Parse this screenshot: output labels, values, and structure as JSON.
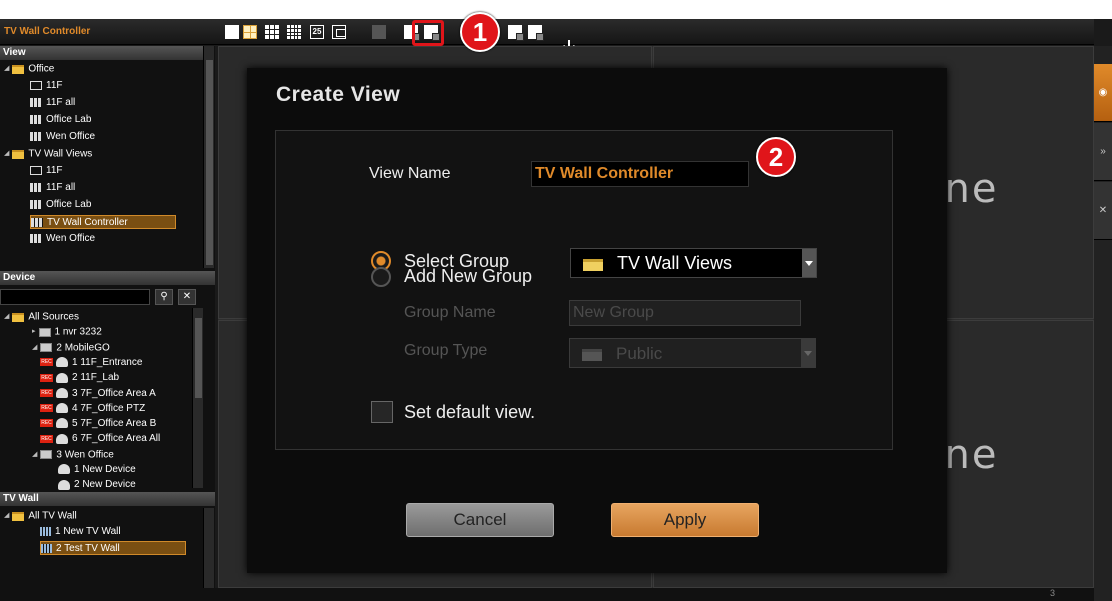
{
  "app": {
    "title": "TV Wall Controller"
  },
  "callouts": [
    "1",
    "2"
  ],
  "left_panel": {
    "view_header": "View",
    "views": [
      {
        "label": "Office",
        "type": "folder"
      },
      {
        "label": "11F",
        "type": "single"
      },
      {
        "label": "11F all",
        "type": "mixed"
      },
      {
        "label": "Office Lab",
        "type": "quad"
      },
      {
        "label": "Wen Office",
        "type": "grid"
      },
      {
        "label": "TV Wall Views",
        "type": "folder"
      },
      {
        "label": "11F",
        "type": "single"
      },
      {
        "label": "11F all",
        "type": "mixed"
      },
      {
        "label": "Office Lab",
        "type": "quad"
      },
      {
        "label": "TV Wall Controller",
        "type": "quad",
        "selected": true
      },
      {
        "label": "Wen Office",
        "type": "grid"
      }
    ],
    "device_header": "Device",
    "devices": [
      {
        "label": "All Sources"
      },
      {
        "label": "1 nvr 3232"
      },
      {
        "label": "2 MobileGO"
      },
      {
        "label": "1 11F_Entrance"
      },
      {
        "label": "2 11F_Lab"
      },
      {
        "label": "3 7F_Office Area A"
      },
      {
        "label": "4 7F_Office PTZ"
      },
      {
        "label": "5 7F_Office Area B"
      },
      {
        "label": "6 7F_Office Area All"
      },
      {
        "label": "3 Wen Office"
      },
      {
        "label": "1 New Device"
      },
      {
        "label": "2 New Device"
      }
    ],
    "tvwall_header": "TV Wall",
    "tvwalls": [
      {
        "label": "All TV Wall"
      },
      {
        "label": "1 New TV Wall"
      },
      {
        "label": "2 Test TV Wall",
        "selected": true
      }
    ]
  },
  "main": {
    "brand_text": "one"
  },
  "status": {
    "count": "3"
  },
  "dialog": {
    "title": "Create View",
    "view_name_label": "View Name",
    "view_name_value": "TV Wall Controller",
    "select_group_label": "Select Group",
    "select_group_value": "TV  Wall Views",
    "add_group_label": "Add New Group",
    "group_name_label": "Group Name",
    "group_name_placeholder": "New Group",
    "group_type_label": "Group Type",
    "group_type_value": "Public",
    "default_view_label": "Set default view.",
    "cancel_label": "Cancel",
    "apply_label": "Apply"
  },
  "colors": {
    "accent": "#e08a2a",
    "callout": "#e0151a"
  }
}
